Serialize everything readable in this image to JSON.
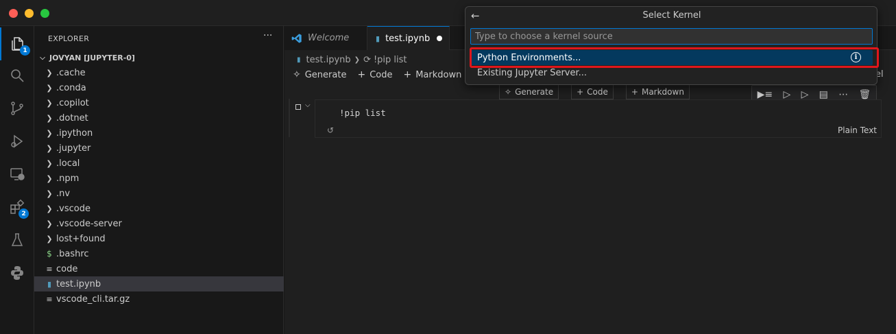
{
  "titlebar": {},
  "activitybar": {
    "items": [
      {
        "icon": "files-icon",
        "badge": "1"
      },
      {
        "icon": "search-icon"
      },
      {
        "icon": "source-control-icon"
      },
      {
        "icon": "run-debug-icon"
      },
      {
        "icon": "remote-explorer-icon"
      },
      {
        "icon": "extensions-icon",
        "badge": "2"
      },
      {
        "icon": "testing-icon"
      },
      {
        "icon": "python-icon"
      }
    ]
  },
  "sidebar": {
    "header": "EXPLORER",
    "more": "···",
    "section": "JOVYAN [JUPYTER-0]",
    "items": [
      {
        "label": ".cache",
        "kind": "folder"
      },
      {
        "label": ".conda",
        "kind": "folder"
      },
      {
        "label": ".copilot",
        "kind": "folder"
      },
      {
        "label": ".dotnet",
        "kind": "folder"
      },
      {
        "label": ".ipython",
        "kind": "folder"
      },
      {
        "label": ".jupyter",
        "kind": "folder"
      },
      {
        "label": ".local",
        "kind": "folder"
      },
      {
        "label": ".npm",
        "kind": "folder"
      },
      {
        "label": ".nv",
        "kind": "folder"
      },
      {
        "label": ".vscode",
        "kind": "folder"
      },
      {
        "label": ".vscode-server",
        "kind": "folder"
      },
      {
        "label": "lost+found",
        "kind": "folder"
      },
      {
        "label": ".bashrc",
        "kind": "shell"
      },
      {
        "label": "code",
        "kind": "file"
      },
      {
        "label": "test.ipynb",
        "kind": "notebook"
      },
      {
        "label": "vscode_cli.tar.gz",
        "kind": "file"
      }
    ]
  },
  "editor": {
    "tabs": [
      {
        "label": "Welcome"
      },
      {
        "label": "test.ipynb"
      }
    ],
    "breadcrumb": {
      "file": "test.ipynb",
      "cell": "!pip list"
    },
    "toolbar": {
      "generate": "Generate",
      "code": "Code",
      "markdown": "Markdown",
      "kernel_tail": "el"
    },
    "insert_bar": {
      "generate": "Generate",
      "code": "Code",
      "markdown": "Markdown"
    },
    "cell": {
      "code": "!pip list",
      "language": "Plain Text"
    }
  },
  "quickpick": {
    "title": "Select Kernel",
    "placeholder": "Type to choose a kernel source",
    "items": [
      {
        "label": "Python Environments..."
      },
      {
        "label": "Existing Jupyter Server..."
      }
    ]
  },
  "colors": {
    "accent": "#0078d4",
    "highlight": "#e0161b",
    "selection": "#04395e"
  }
}
